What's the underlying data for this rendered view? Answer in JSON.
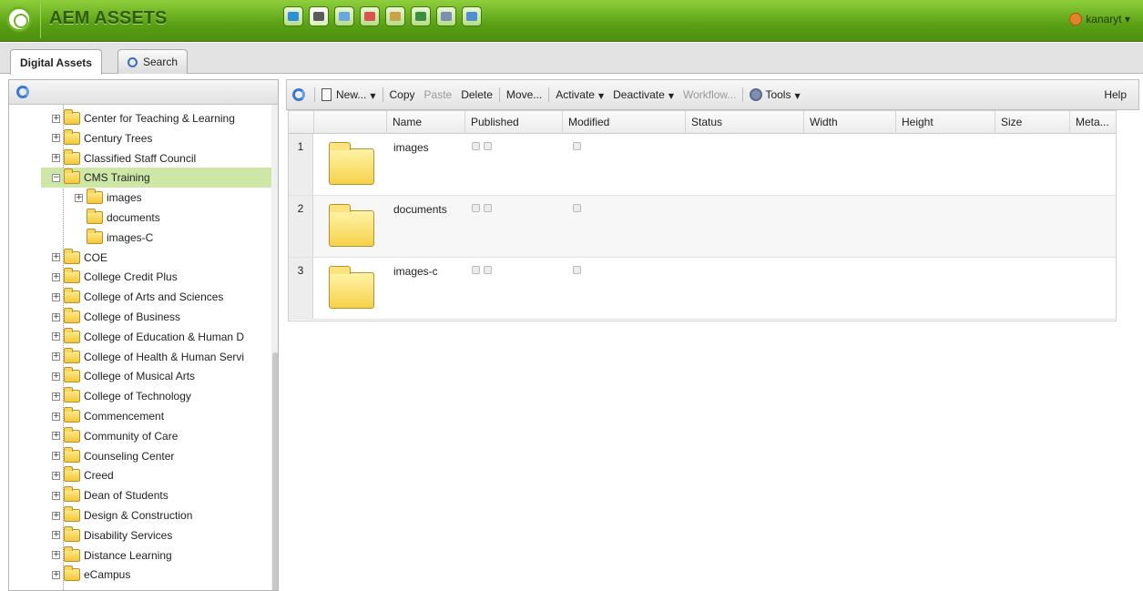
{
  "app": {
    "title": "AEM ASSETS",
    "user": "kanaryt ▾"
  },
  "nav_icons": [
    {
      "icon": "globe-icon",
      "color": "#2d8fd6"
    },
    {
      "icon": "assets-icon",
      "color": "#5a5a5a"
    },
    {
      "icon": "community-icon",
      "color": "#6aa6e0"
    },
    {
      "icon": "campaigns-icon",
      "color": "#d9534f"
    },
    {
      "icon": "inbox-icon",
      "color": "#c9a34a"
    },
    {
      "icon": "users-icon",
      "color": "#3f8d3f"
    },
    {
      "icon": "tools-icon",
      "color": "#7d8fb3"
    },
    {
      "icon": "tagging-icon",
      "color": "#4f8fd0"
    }
  ],
  "tabs": {
    "assets": "Digital Assets",
    "search": "Search"
  },
  "tree": [
    {
      "label": "Center for Teaching & Learning",
      "level": 1,
      "expander": "+"
    },
    {
      "label": "Century Trees",
      "level": 1,
      "expander": "+"
    },
    {
      "label": "Classified Staff Council",
      "level": 1,
      "expander": "+"
    },
    {
      "label": "CMS Training",
      "level": 1,
      "expander": "−",
      "selected": true
    },
    {
      "label": "images",
      "level": 2,
      "expander": "+"
    },
    {
      "label": "documents",
      "level": 2,
      "expander": ""
    },
    {
      "label": "images-C",
      "level": 2,
      "expander": ""
    },
    {
      "label": "COE",
      "level": 1,
      "expander": "+"
    },
    {
      "label": "College Credit Plus",
      "level": 1,
      "expander": "+"
    },
    {
      "label": "College of Arts and Sciences",
      "level": 1,
      "expander": "+"
    },
    {
      "label": "College of Business",
      "level": 1,
      "expander": "+"
    },
    {
      "label": "College of Education & Human D",
      "level": 1,
      "expander": "+"
    },
    {
      "label": "College of Health & Human Servi",
      "level": 1,
      "expander": "+"
    },
    {
      "label": "College of Musical Arts",
      "level": 1,
      "expander": "+"
    },
    {
      "label": "College of Technology",
      "level": 1,
      "expander": "+"
    },
    {
      "label": "Commencement",
      "level": 1,
      "expander": "+"
    },
    {
      "label": "Community of Care",
      "level": 1,
      "expander": "+"
    },
    {
      "label": "Counseling Center",
      "level": 1,
      "expander": "+"
    },
    {
      "label": "Creed",
      "level": 1,
      "expander": "+"
    },
    {
      "label": "Dean of Students",
      "level": 1,
      "expander": "+"
    },
    {
      "label": "Design & Construction",
      "level": 1,
      "expander": "+"
    },
    {
      "label": "Disability Services",
      "level": 1,
      "expander": "+"
    },
    {
      "label": "Distance Learning",
      "level": 1,
      "expander": "+"
    },
    {
      "label": "eCampus",
      "level": 1,
      "expander": "+"
    }
  ],
  "toolbar": {
    "new": "New...",
    "copy": "Copy",
    "paste": "Paste",
    "delete": "Delete",
    "move": "Move...",
    "activate": "Activate",
    "deactivate": "Deactivate",
    "workflow": "Workflow...",
    "tools": "Tools",
    "help": "Help"
  },
  "columns": [
    "Name",
    "Published",
    "Modified",
    "Status",
    "Width",
    "Height",
    "Size",
    "Meta..."
  ],
  "rows": [
    {
      "num": "1",
      "name": "images"
    },
    {
      "num": "2",
      "name": "documents"
    },
    {
      "num": "3",
      "name": "images-c"
    }
  ]
}
